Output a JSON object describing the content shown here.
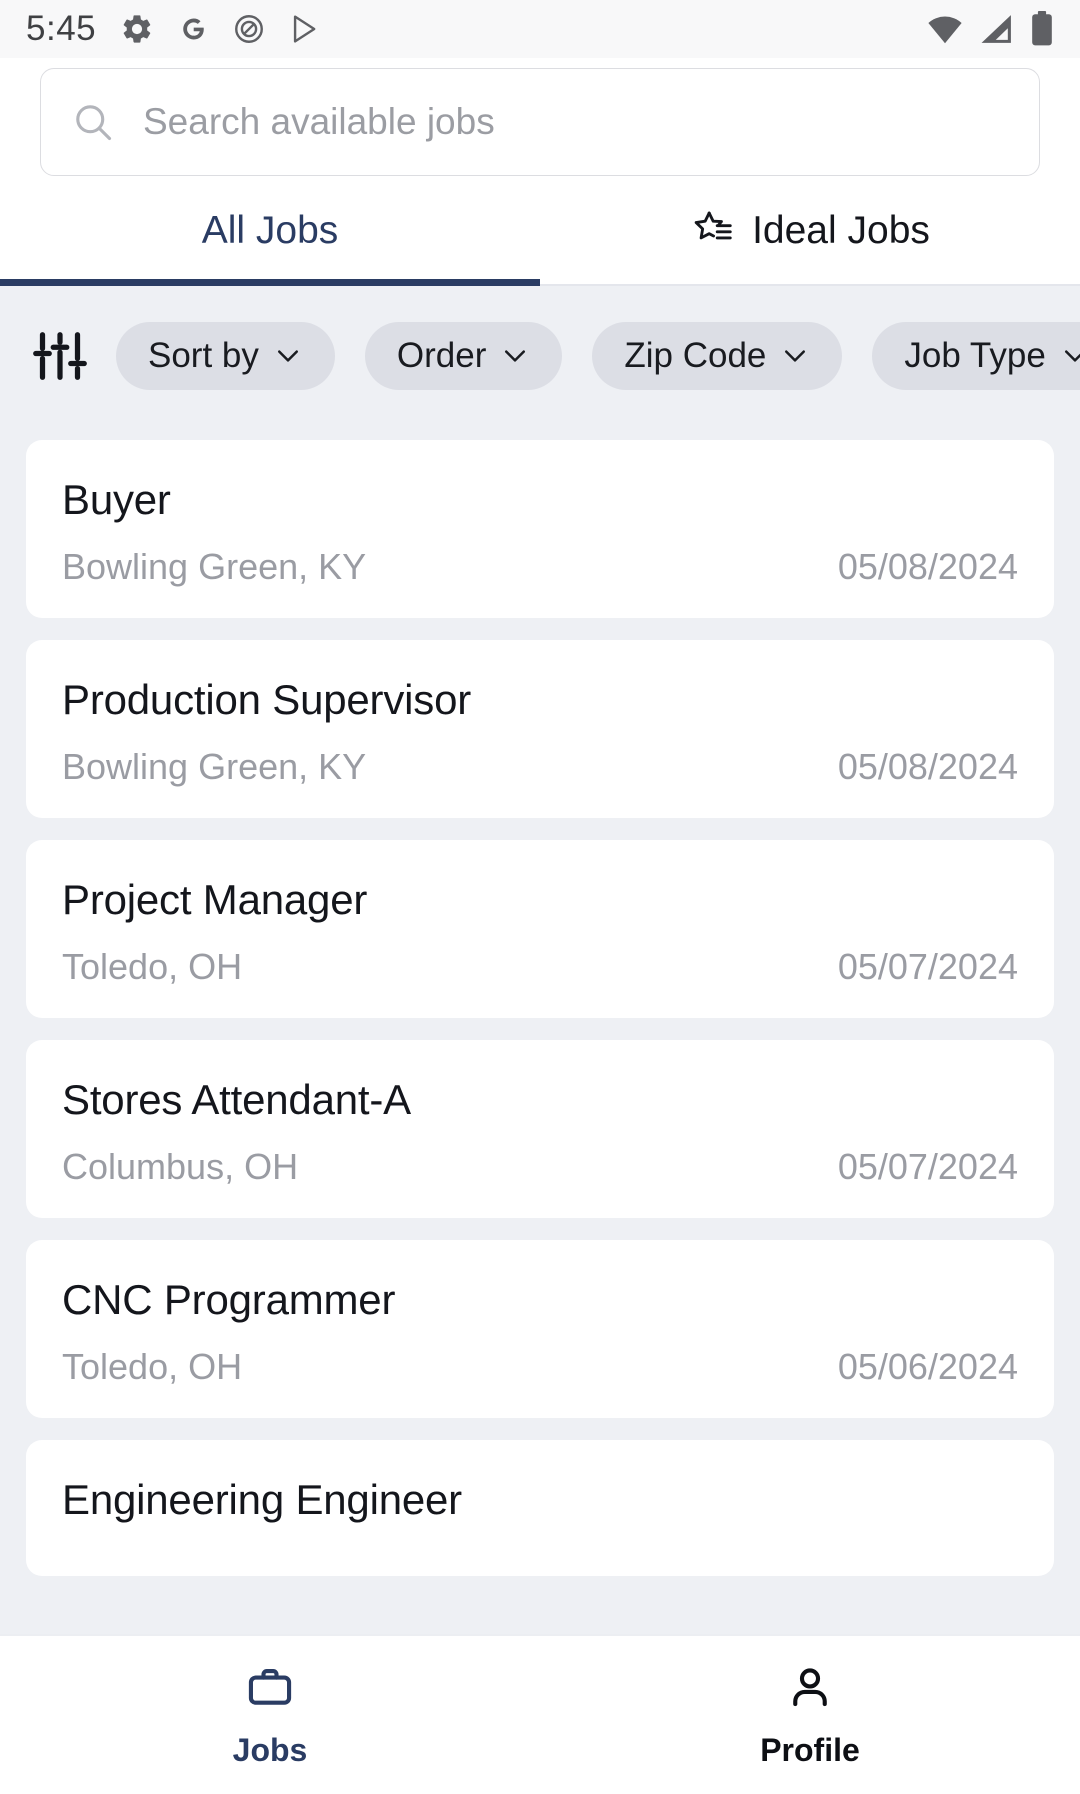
{
  "status_bar": {
    "time": "5:45",
    "left_icons": [
      "gear-icon",
      "google-icon",
      "camera-lens-icon",
      "play-store-icon"
    ],
    "right_icons": [
      "wifi-icon",
      "cellular-signal-icon",
      "battery-icon"
    ]
  },
  "search": {
    "placeholder": "Search available jobs",
    "value": "",
    "icon": "search-icon"
  },
  "tabs": {
    "active_index": 0,
    "items": [
      {
        "label": "All Jobs",
        "icon": null
      },
      {
        "label": "Ideal Jobs",
        "icon": "star-list-icon"
      }
    ]
  },
  "filters": {
    "tune_icon": "tune-sliders-icon",
    "chips": [
      {
        "label": "Sort by",
        "icon": "chevron-down-icon"
      },
      {
        "label": "Order",
        "icon": "chevron-down-icon"
      },
      {
        "label": "Zip Code",
        "icon": "chevron-down-icon"
      },
      {
        "label": "Job Type",
        "icon": "chevron-down-icon"
      }
    ]
  },
  "jobs": [
    {
      "title": "Buyer",
      "location": "Bowling Green, KY",
      "date": "05/08/2024"
    },
    {
      "title": "Production Supervisor",
      "location": "Bowling Green, KY",
      "date": "05/08/2024"
    },
    {
      "title": "Project Manager",
      "location": "Toledo, OH",
      "date": "05/07/2024"
    },
    {
      "title": "Stores Attendant-A",
      "location": "Columbus, OH",
      "date": "05/07/2024"
    },
    {
      "title": "CNC Programmer",
      "location": "Toledo, OH",
      "date": "05/06/2024"
    },
    {
      "title": "Engineering Engineer",
      "location": "",
      "date": ""
    }
  ],
  "bottom_nav": {
    "active_index": 0,
    "items": [
      {
        "label": "Jobs",
        "icon": "briefcase-icon"
      },
      {
        "label": "Profile",
        "icon": "person-icon"
      }
    ]
  },
  "colors": {
    "accent_navy": "#2a3c63",
    "page_bg": "#eef0f4",
    "card_bg": "#ffffff",
    "muted_text": "#9a9ca3",
    "chip_bg": "#dcdee5"
  }
}
